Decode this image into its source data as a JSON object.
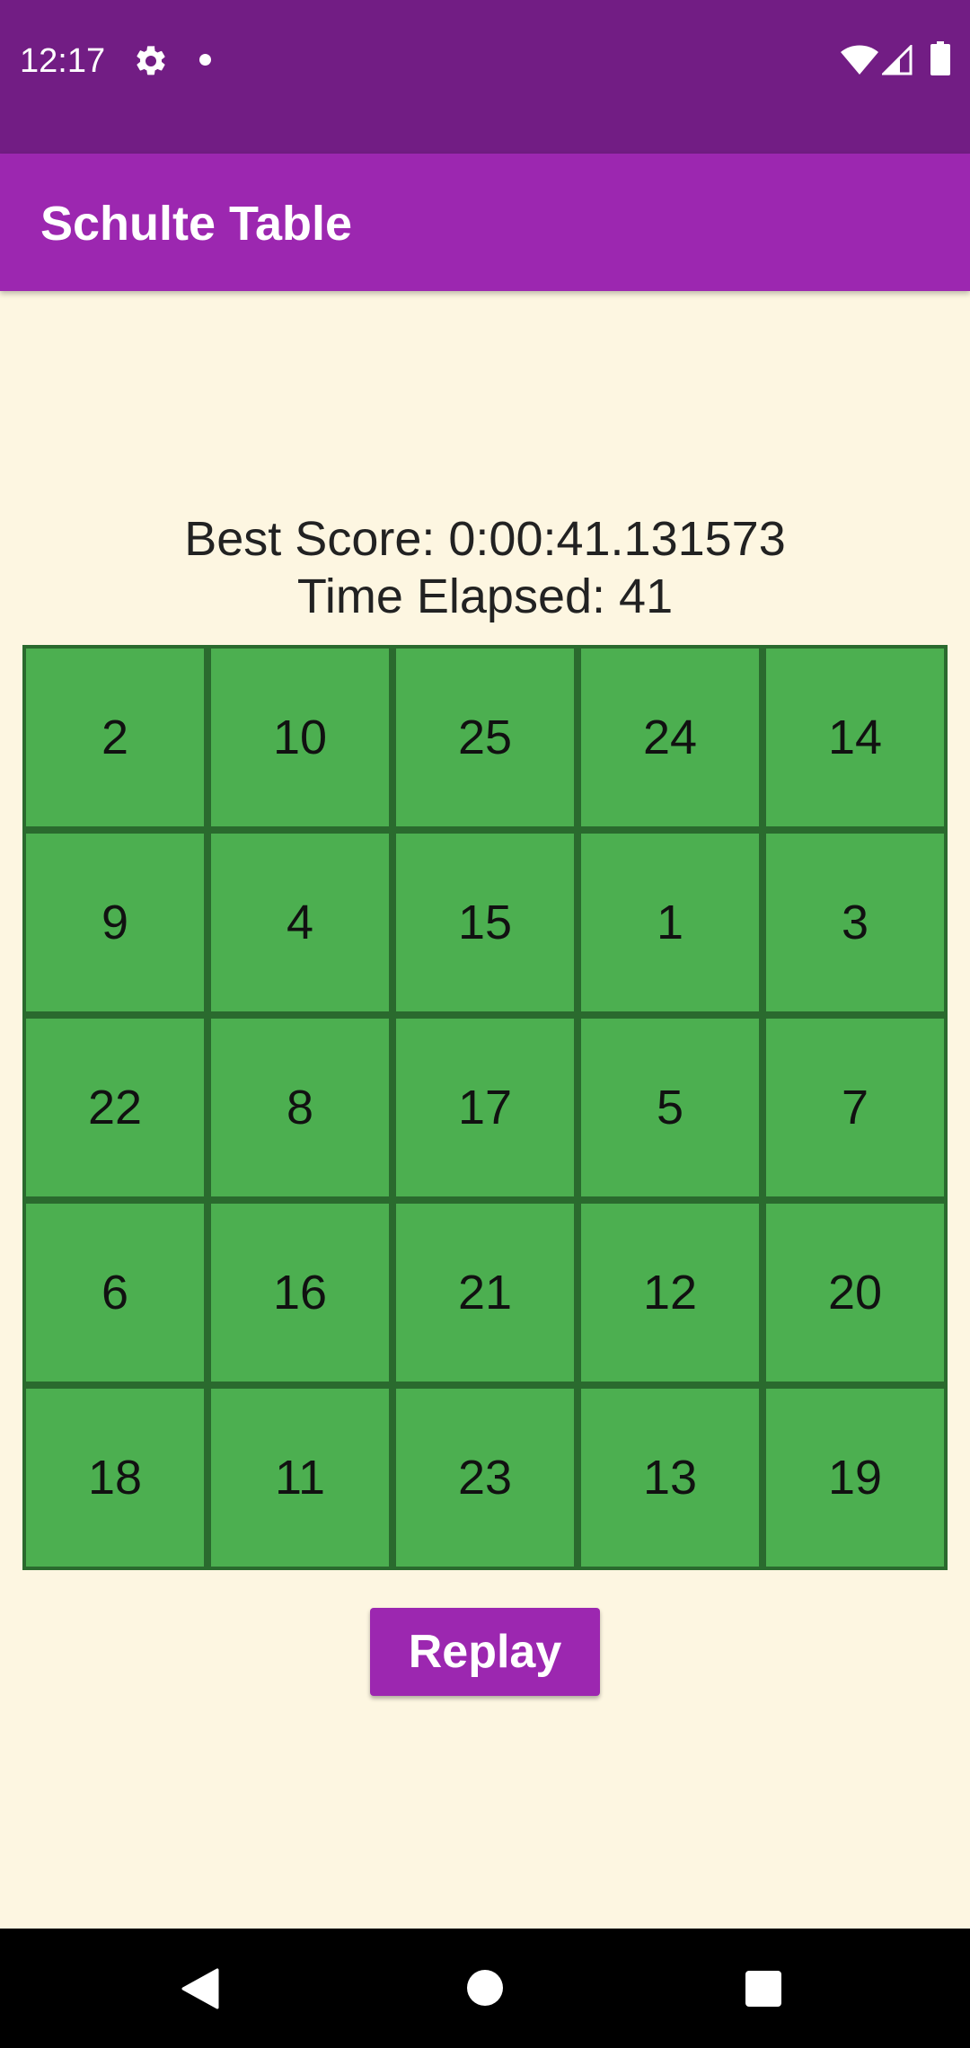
{
  "status_bar": {
    "time": "12:17",
    "icons": [
      "gear-icon",
      "notification-dot-icon",
      "wifi-icon",
      "signal-icon",
      "battery-icon"
    ]
  },
  "app_bar": {
    "title": "Schulte Table"
  },
  "scores": {
    "best_score": "Best Score: 0:00:41.131573",
    "time_elapsed": "Time Elapsed: 41"
  },
  "grid": {
    "rows": [
      [
        "2",
        "10",
        "25",
        "24",
        "14"
      ],
      [
        "9",
        "4",
        "15",
        "1",
        "3"
      ],
      [
        "22",
        "8",
        "17",
        "5",
        "7"
      ],
      [
        "6",
        "16",
        "21",
        "12",
        "20"
      ],
      [
        "18",
        "11",
        "23",
        "13",
        "19"
      ]
    ]
  },
  "replay_button": {
    "label": "Replay"
  },
  "nav_bar": {
    "icons": [
      "back-icon",
      "home-icon",
      "recents-icon"
    ]
  },
  "colors": {
    "status_bar": "#721d84",
    "app_bar": "#9c27b0",
    "background": "#fdf6e1",
    "cell": "#4caf50",
    "grid_border": "#2a6a2e",
    "button": "#9c27b0"
  }
}
